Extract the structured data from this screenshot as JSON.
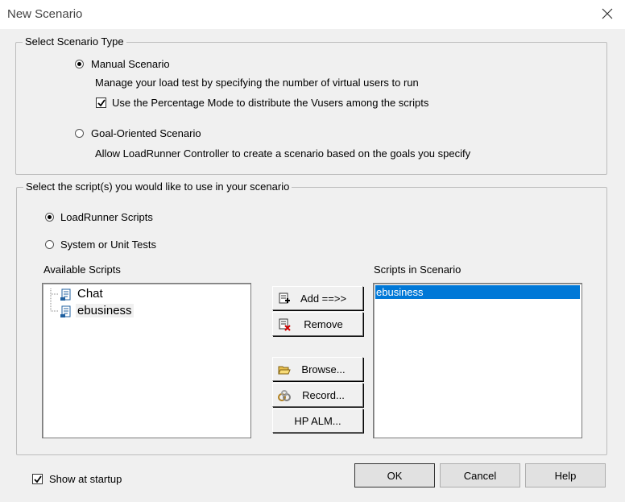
{
  "window": {
    "title": "New Scenario"
  },
  "scenario_type": {
    "legend": "Select Scenario Type",
    "manual": {
      "label": "Manual Scenario",
      "selected": true,
      "description": "Manage your load test by specifying the number of virtual users to run",
      "percentage_mode": {
        "label": "Use the Percentage Mode to distribute the Vusers among the scripts",
        "checked": true
      }
    },
    "goal": {
      "label": "Goal-Oriented Scenario",
      "selected": false,
      "description": "Allow LoadRunner Controller to create a scenario based on the goals you specify"
    }
  },
  "scripts": {
    "legend": "Select the script(s) you would like to use in your scenario",
    "loadrunner": {
      "label": "LoadRunner Scripts",
      "selected": true
    },
    "system": {
      "label": "System or Unit Tests",
      "selected": false
    },
    "available_label": "Available Scripts",
    "available_items": [
      "Chat",
      "ebusiness"
    ],
    "in_scenario_label": "Scripts in Scenario",
    "in_scenario_items": [
      "ebusiness"
    ],
    "buttons": {
      "add": "Add ==>>",
      "remove": "Remove",
      "browse": "Browse...",
      "record": "Record...",
      "hp_alm": "HP ALM..."
    }
  },
  "footer": {
    "show_at_startup": {
      "label": "Show at startup",
      "checked": true
    },
    "ok": "OK",
    "cancel": "Cancel",
    "help": "Help"
  }
}
